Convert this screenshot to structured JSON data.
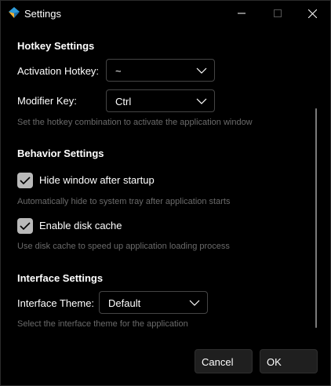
{
  "window": {
    "title": "Settings",
    "icon": "app-logo-icon",
    "controls": [
      "minimize-icon",
      "maximize-icon",
      "close-icon"
    ]
  },
  "hotkey": {
    "section_title": "Hotkey Settings",
    "activation_label": "Activation Hotkey:",
    "activation_value": "~",
    "modifier_label": "Modifier Key:",
    "modifier_value": "Ctrl",
    "hint": "Set the hotkey combination to activate the application window"
  },
  "behavior": {
    "section_title": "Behavior Settings",
    "hide_label": "Hide window after startup",
    "hide_checked": true,
    "hide_hint": "Automatically hide to system tray after application starts",
    "disk_label": "Enable disk cache",
    "disk_checked": true,
    "disk_hint": "Use disk cache to speed up application loading process"
  },
  "interface": {
    "section_title": "Interface Settings",
    "theme_label": "Interface Theme:",
    "theme_value": "Default",
    "hint": "Select the interface theme for the application"
  },
  "footer": {
    "cancel_label": "Cancel",
    "ok_label": "OK"
  },
  "colors": {
    "background": "#000000",
    "hint_text": "#6a6a6a",
    "checkbox_fill": "#b9b9b9",
    "button_bg": "#1f1f1f"
  }
}
